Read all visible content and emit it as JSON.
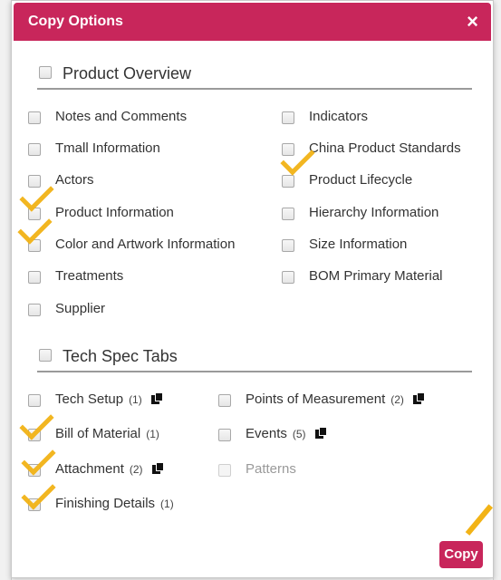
{
  "dialog": {
    "title": "Copy Options",
    "close_label": "×"
  },
  "sections": {
    "product_overview": {
      "title": "Product Overview",
      "items": [
        {
          "label": "Notes and Comments"
        },
        {
          "label": "Tmall Information"
        },
        {
          "label": "Actors"
        },
        {
          "label": "Product Information"
        },
        {
          "label": "Color and Artwork Information"
        },
        {
          "label": "Treatments"
        },
        {
          "label": "Supplier"
        },
        {
          "label": "Indicators"
        },
        {
          "label": "China Product Standards"
        },
        {
          "label": "Product Lifecycle"
        },
        {
          "label": "Hierarchy Information"
        },
        {
          "label": "Size Information"
        },
        {
          "label": "BOM Primary Material"
        }
      ]
    },
    "tech_spec": {
      "title": "Tech Spec Tabs",
      "items": [
        {
          "label": "Tech Setup",
          "count": "(1)"
        },
        {
          "label": "Bill of Material",
          "count": "(1)"
        },
        {
          "label": "Attachment",
          "count": "(2)"
        },
        {
          "label": "Finishing Details",
          "count": "(1)"
        },
        {
          "label": "Points of Measurement",
          "count": "(2)"
        },
        {
          "label": "Events",
          "count": "(5)"
        },
        {
          "label": "Patterns",
          "count": ""
        }
      ]
    }
  },
  "footer": {
    "copy_label": "Copy"
  },
  "colors": {
    "accent": "#c8265b",
    "annotation": "#f2b316"
  },
  "icons": {
    "copy": "copy-icon",
    "checkmark_annotation": "checkmark-annotation-icon"
  }
}
